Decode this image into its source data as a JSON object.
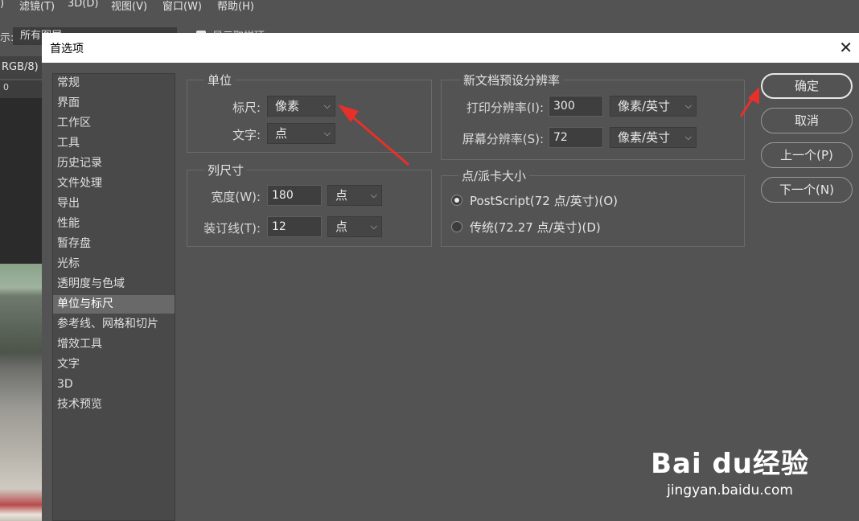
{
  "background_app": {
    "menu_items": [
      "滤镜(T)",
      "3D(D)",
      "视图(V)",
      "窗口(W)",
      "帮助(H)"
    ],
    "options_label": "示:",
    "options_select": "所有图层",
    "options_checkbox": "显示取样环",
    "doc_tab": "RGB/8)",
    "ruler_mark": "0"
  },
  "dialog": {
    "title": "首选项",
    "close_glyph": "✕"
  },
  "categories": [
    {
      "label": "常规"
    },
    {
      "label": "界面"
    },
    {
      "label": "工作区"
    },
    {
      "label": "工具"
    },
    {
      "label": "历史记录"
    },
    {
      "label": "文件处理"
    },
    {
      "label": "导出"
    },
    {
      "label": "性能"
    },
    {
      "label": "暂存盘"
    },
    {
      "label": "光标"
    },
    {
      "label": "透明度与色域"
    },
    {
      "label": "单位与标尺",
      "selected": true
    },
    {
      "label": "参考线、网格和切片"
    },
    {
      "label": "增效工具"
    },
    {
      "label": "文字"
    },
    {
      "label": "3D"
    },
    {
      "label": "技术预览"
    }
  ],
  "units": {
    "title": "单位",
    "ruler_label": "标尺:",
    "ruler_value": "像素",
    "type_label": "文字:",
    "type_value": "点"
  },
  "column_size": {
    "title": "列尺寸",
    "width_label": "宽度(W):",
    "width_value": "180",
    "width_unit": "点",
    "gutter_label": "装订线(T):",
    "gutter_value": "12",
    "gutter_unit": "点"
  },
  "new_doc_resolution": {
    "title": "新文档预设分辨率",
    "print_label": "打印分辨率(I):",
    "print_value": "300",
    "print_unit": "像素/英寸",
    "screen_label": "屏幕分辨率(S):",
    "screen_value": "72",
    "screen_unit": "像素/英寸"
  },
  "point_size": {
    "title": "点/派卡大小",
    "postscript_label": "PostScript(72 点/英寸)(O)",
    "traditional_label": "传统(72.27 点/英寸)(D)",
    "selected": "postscript"
  },
  "buttons": {
    "ok": "确定",
    "cancel": "取消",
    "prev": "上一个(P)",
    "next": "下一个(N)"
  },
  "icons": {
    "dropdown": "chevron-down-icon",
    "close": "close-icon",
    "annotation": "red-arrow-icon"
  },
  "colors": {
    "dialog_bg": "#535353",
    "selected_item": "#696969",
    "annotation_arrow": "#e8302a"
  },
  "watermark": {
    "logo_text": "Bai du经验",
    "url": "jingyan.baidu.com"
  }
}
